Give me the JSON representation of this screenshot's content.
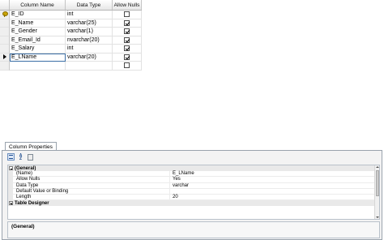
{
  "grid": {
    "headers": {
      "column_name": "Column Name",
      "data_type": "Data Type",
      "allow_nulls": "Allow Nulls"
    },
    "rows": [
      {
        "name": "E_ID",
        "type": "int",
        "allow_nulls": false,
        "marker": "key-icon"
      },
      {
        "name": "E_Name",
        "type": "varchar(25)",
        "allow_nulls": true,
        "marker": ""
      },
      {
        "name": "E_Gender",
        "type": "varchar(1)",
        "allow_nulls": true,
        "marker": ""
      },
      {
        "name": "E_Email_Id",
        "type": "nvarchar(20)",
        "allow_nulls": true,
        "marker": ""
      },
      {
        "name": "E_Salary",
        "type": "int",
        "allow_nulls": true,
        "marker": ""
      },
      {
        "name": "E_LName",
        "type": "varchar(20)",
        "allow_nulls": true,
        "marker": "current-row-arrow-icon"
      },
      {
        "name": "",
        "type": "",
        "allow_nulls": false,
        "marker": ""
      }
    ]
  },
  "properties": {
    "tab_label": "Column Properties",
    "toolbar": {
      "categorized": "categorized-icon",
      "alphabetical": "sort-alphabetical-icon",
      "property_pages": "property-pages-icon"
    },
    "general_category": "(General)",
    "items": [
      {
        "name": "(Name)",
        "value": "E_LName"
      },
      {
        "name": "Allow Nulls",
        "value": "Yes"
      },
      {
        "name": "Data Type",
        "value": "varchar"
      },
      {
        "name": "Default Value or Binding",
        "value": ""
      },
      {
        "name": "Length",
        "value": "20"
      }
    ],
    "next_category": "Table Designer",
    "description_title": "(General)"
  }
}
